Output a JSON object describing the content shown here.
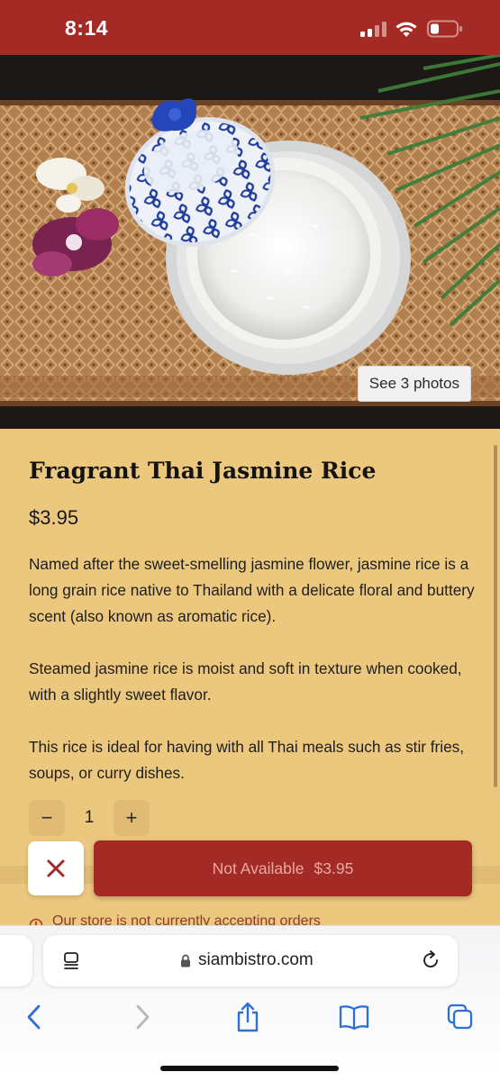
{
  "status_bar": {
    "time": "8:14",
    "color": "#a42a26"
  },
  "product": {
    "see_photos_label": "See 3 photos",
    "title": "Fragrant Thai Jasmine Rice",
    "price": "$3.95",
    "description": [
      "Named after the sweet-smelling jasmine flower, jasmine rice is a long grain rice native to Thailand with a delicate floral and buttery scent (also known as aromatic rice).",
      "Steamed jasmine rice is moist and soft in texture when cooked, with a slightly sweet flavor.",
      "This rice is ideal for having with all Thai meals such as stir fries, soups, or curry dishes."
    ],
    "quantity": "1",
    "decrement_symbol": "−",
    "increment_symbol": "+",
    "add_button": {
      "label": "Not Available",
      "price": "$3.95"
    },
    "notice": "Our store is not currently accepting orders"
  },
  "browser": {
    "domain": "siambistro.com",
    "icons": [
      "page-format-icon",
      "lock-icon",
      "reload-icon",
      "back-icon",
      "forward-icon",
      "share-icon",
      "bookmarks-icon",
      "tabs-icon"
    ]
  },
  "colors": {
    "brand": "#a42a26",
    "background": "#ecc77e",
    "accent_link": "#2f6fd6"
  }
}
